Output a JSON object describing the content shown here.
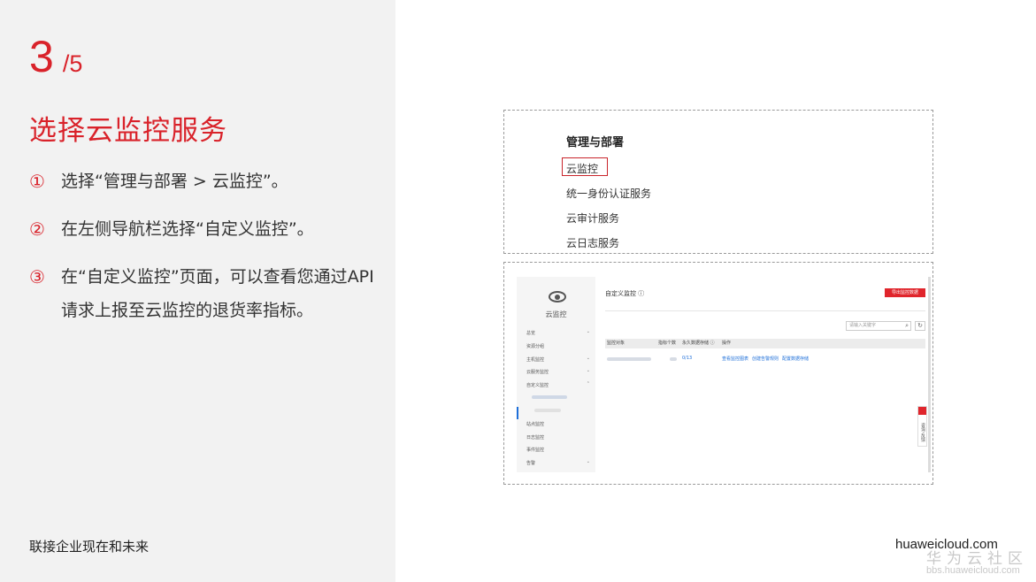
{
  "slide": {
    "step_current": "3",
    "step_total": "/5",
    "title": "选择云监控服务",
    "steps": [
      {
        "bullet": "①",
        "text": "选择“管理与部署 > 云监控”。"
      },
      {
        "bullet": "②",
        "text": "在左侧导航栏选择“自定义监控”。"
      },
      {
        "bullet": "③",
        "text": "在“自定义监控”页面，可以查看您通过API请求上报至云监控的退货率指标。"
      }
    ],
    "footer_left": "联接企业现在和未来",
    "footer_right": "huaweicloud.com",
    "watermark_cn": "华为云社区",
    "watermark_url": "bbs.huaweicloud.com"
  },
  "menu_screenshot": {
    "heading": "管理与部署",
    "items": [
      "云监控",
      "统一身份认证服务",
      "云审计服务",
      "云日志服务"
    ],
    "selected_index": 0
  },
  "console_screenshot": {
    "service_name": "云监控",
    "nav": [
      {
        "label": "总览",
        "chevron": "⌄"
      },
      {
        "label": "资源分组",
        "chevron": ""
      },
      {
        "label": "主机监控",
        "chevron": "⌄"
      },
      {
        "label": "云服务监控",
        "chevron": "⌄"
      },
      {
        "label": "自定义监控",
        "chevron": "⌃"
      },
      {
        "label": "站点监控",
        "chevron": ""
      },
      {
        "label": "日志监控",
        "chevron": ""
      },
      {
        "label": "事件监控",
        "chevron": ""
      },
      {
        "label": "告警",
        "chevron": "⌄"
      }
    ],
    "page_title": "自定义监控 ⓘ",
    "export_button": "导出监控数据",
    "search_placeholder": "请输入关键字",
    "search_icon": "search-icon",
    "refresh_icon": "↻",
    "table_headers": [
      "监控对象",
      "指标个数",
      "永久数据存储 ⓘ",
      "操作"
    ],
    "row": {
      "retention": "0/13",
      "actions": [
        "查看监控图表",
        "创建告警规则",
        "配置数据存储"
      ]
    },
    "feedback_tab": "咨询·反馈"
  }
}
